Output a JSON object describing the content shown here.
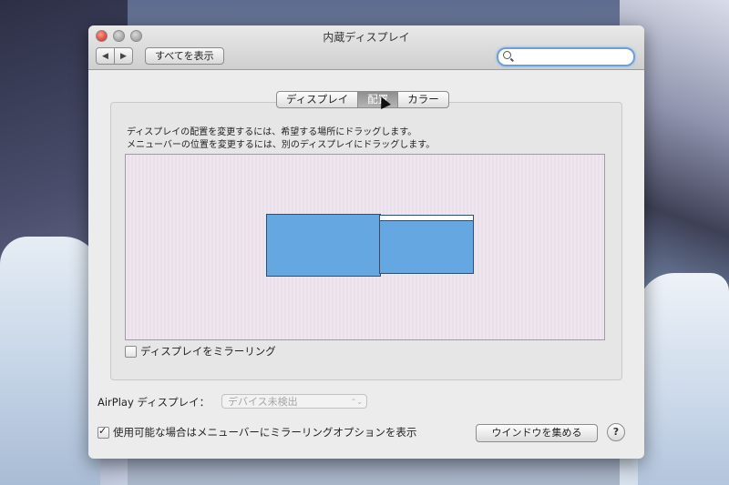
{
  "window": {
    "title": "内蔵ディスプレイ"
  },
  "toolbar": {
    "back_icon": "◀",
    "forward_icon": "▶",
    "show_all_label": "すべてを表示",
    "search": {
      "value": "",
      "placeholder": ""
    }
  },
  "tabs": [
    {
      "label": "ディスプレイ",
      "active": false
    },
    {
      "label": "配置",
      "active": true
    },
    {
      "label": "カラー",
      "active": false
    }
  ],
  "arrangement": {
    "instruction_line1": "ディスプレイの配置を変更するには、希望する場所にドラッグします。",
    "instruction_line2": "メニューバーの位置を変更するには、別のディスプレイにドラッグします。",
    "display_color": "#65a7e0"
  },
  "mirror": {
    "label": "ディスプレイをミラーリング",
    "checked": false
  },
  "airplay": {
    "label": "AirPlay ディスプレイ：",
    "selected": "デバイス未検出",
    "arrows": "⌃⌄"
  },
  "show_mirroring": {
    "label": "使用可能な場合はメニューバーにミラーリングオプションを表示",
    "checked": true
  },
  "gather_windows_label": "ウインドウを集める",
  "help_label": "?"
}
